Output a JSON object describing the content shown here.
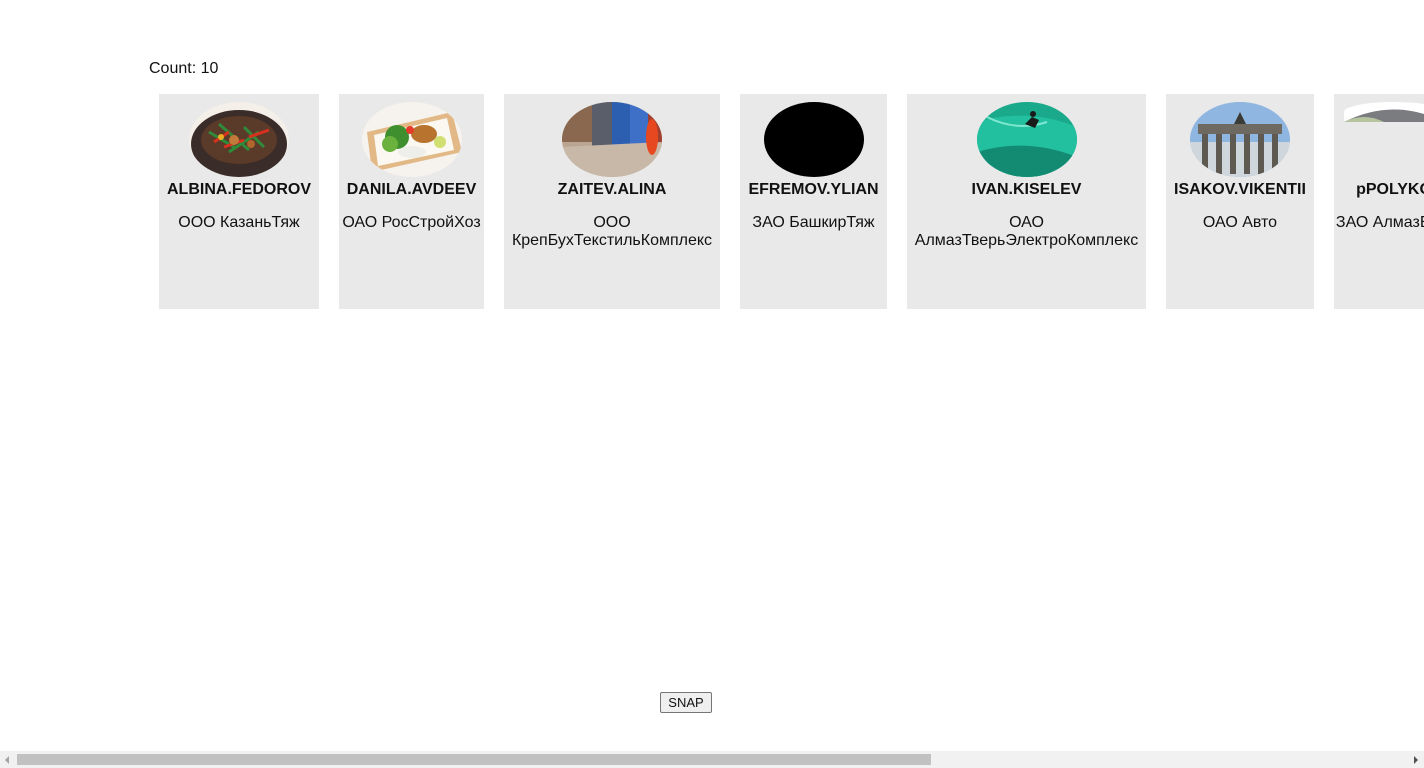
{
  "count_label": "Count: 10",
  "cards": [
    {
      "username": "ALBINA.FEDOROV",
      "company": "ООО КазаньТяж",
      "image_icon": "food-bowl-image"
    },
    {
      "username": "DANILA.AVDEEV",
      "company": "ОАО РосСтройХоз",
      "image_icon": "food-box-image"
    },
    {
      "username": "ZAITEV.ALINA",
      "company": "ООО КрепБухТекстильКомплекс",
      "image_icon": "street-doors-image"
    },
    {
      "username": "EFREMOV.YLIAN",
      "company": "ЗАО БашкирТяж",
      "image_icon": "black-placeholder-image"
    },
    {
      "username": "IVAN.KISELEV",
      "company": "ОАО АлмазТверьЭлектроКомплекс",
      "image_icon": "surfer-wave-image"
    },
    {
      "username": "ISAKOV.VIKENTII",
      "company": "ОАО Авто",
      "image_icon": "brandenburg-gate-image"
    },
    {
      "username": "pPOLYKO",
      "company": "ЗАО АлмазБаш",
      "image_icon": "umbrella-image"
    }
  ],
  "snap_button": "SNAP",
  "colors": {
    "card_background": "#e9e9e9",
    "page_background": "#ffffff",
    "scrollbar_track": "#f1f1f1",
    "scrollbar_thumb": "#c1c1c1"
  }
}
